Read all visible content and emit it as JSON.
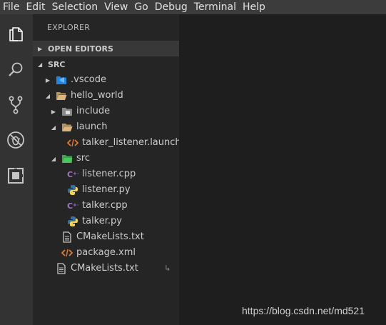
{
  "menu": [
    "File",
    "Edit",
    "Selection",
    "View",
    "Go",
    "Debug",
    "Terminal",
    "Help"
  ],
  "activity_bar": {
    "icons": [
      "explorer-icon",
      "search-icon",
      "source-control-icon",
      "debug-icon",
      "extensions-icon"
    ]
  },
  "sidebar": {
    "title": "EXPLORER",
    "open_editors": "OPEN EDITORS",
    "workspace": "SRC",
    "tree": [
      {
        "label": ".vscode",
        "icon": "vscode-folder-icon",
        "twisty": "collapsed"
      },
      {
        "label": "hello_world",
        "icon": "folder-open-icon",
        "twisty": "expanded"
      },
      {
        "label": "include",
        "icon": "include-folder-icon",
        "twisty": "collapsed"
      },
      {
        "label": "launch",
        "icon": "folder-open-icon",
        "twisty": "expanded"
      },
      {
        "label": "talker_listener.launch",
        "icon": "xml-file-icon",
        "twisty": "none"
      },
      {
        "label": "src",
        "icon": "src-folder-icon",
        "twisty": "expanded"
      },
      {
        "label": "listener.cpp",
        "icon": "cpp-file-icon",
        "twisty": "none"
      },
      {
        "label": "listener.py",
        "icon": "python-file-icon",
        "twisty": "none"
      },
      {
        "label": "talker.cpp",
        "icon": "cpp-file-icon",
        "twisty": "none"
      },
      {
        "label": "talker.py",
        "icon": "python-file-icon",
        "twisty": "none"
      },
      {
        "label": "CMakeLists.txt",
        "icon": "text-file-icon",
        "twisty": "none"
      },
      {
        "label": "package.xml",
        "icon": "xml-file-icon",
        "twisty": "none"
      },
      {
        "label": "CMakeLists.txt",
        "icon": "text-file-icon",
        "twisty": "none",
        "extra": "↳"
      }
    ]
  },
  "watermark": "https://blog.csdn.net/md521",
  "colors": {
    "menubar": "#3c3c3c",
    "activity_bar": "#333333",
    "sidebar": "#252526",
    "editor": "#1e1e1e",
    "folder": "#c09553",
    "cpp": "#a074c4",
    "python_blue": "#3572a5",
    "python_yellow": "#f7d44a",
    "xml": "#e37933",
    "src_folder": "#37a84a",
    "vscode_blue": "#1f88e5"
  }
}
